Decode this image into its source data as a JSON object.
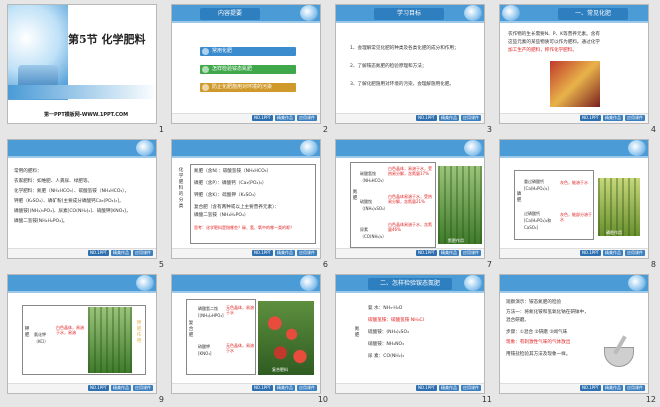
{
  "slides": [
    {
      "num": "1",
      "title": "第5节 化学肥料",
      "site": "第一PPT模板网-WWW.1PPT.COM"
    },
    {
      "num": "2",
      "header": "内容提要",
      "items": [
        "常用化肥",
        "怎样检验铵态氮肥",
        "防止化肥施用对环境的污染"
      ]
    },
    {
      "num": "3",
      "header": "学习目标",
      "items": [
        "1、会理解常见化肥的种类及各类化肥的成分和作用；",
        "2、了解铵态氮肥的检验原理和方法；",
        "3、了解化肥施用对环境的污染，会理解施用化肥。"
      ]
    },
    {
      "num": "4",
      "header": "一、常见化肥",
      "lines": [
        "农作物的生长需要N、P、K等营养元素。含有",
        "这些元素的某些物质可以作为肥料。通过化学",
        "加工生产的肥料，称作化学肥料。"
      ]
    },
    {
      "num": "5",
      "lines": [
        "常用的肥料：",
        "农家肥料：如堆肥、人粪尿、绿肥等。",
        "化学肥料：氮肥（NH₄HCO₃）、碳酸氢铵（NH₄HCO₃），",
        "钾肥（K₂SO₄）、磷矿粉[主要成分磷酸钙Ca₃(PO₄)₂]，",
        "磷酸铵[(NH₄)₃PO₄]、尿素[CO(NH₂)₂]、硝酸钾[KNO₃]，",
        "磷酸二氢铵[NH₄H₂PO₄]。"
      ]
    },
    {
      "num": "6",
      "side": "化学肥料的分类",
      "lines": [
        "氮肥（含N）：碳酸氢铵（NH₄HCO₃）",
        "磷肥（含P）：磷酸钙（Ca₃(PO₄)₂）",
        "钾肥（含K）：硫酸钾（K₂SO₄）",
        "复合肥（含有两种或以上主要营养元素）：",
        "磷酸二氢铵（NH₄H₂PO₄）",
        "思考：化学肥料是指哪些？碳、氢、氧中的哪一类的呢？"
      ]
    },
    {
      "num": "7",
      "side": "氮肥",
      "rows": [
        "碳酸氢铵（NH₄HCO₃）",
        "硫酸铵（(NH₄)₂SO₄）",
        "尿素（CO(NH₂)₂）"
      ],
      "notes": [
        "白色晶体，易溶于水，受热易分解，含氮量17%",
        "白色晶体易溶于水，受热易分解，含氮量21%",
        "白色晶体易溶于水，含氮量46%"
      ],
      "caption": "氮肥作用"
    },
    {
      "num": "8",
      "side": "磷肥",
      "rows": [
        "重过磷酸钙[Ca(H₂PO₄)₂]",
        "过磷酸钙[Ca(H₂PO₄)₂和CaSO₄]"
      ],
      "notes": [
        "灰色，能溶于水",
        "灰色，能部分溶于水"
      ],
      "caption": "磷肥作用"
    },
    {
      "num": "9",
      "side": "钾肥",
      "row": "氯化钾（KCl）",
      "note": "白色晶体，易溶于水，易溶",
      "tag": "钾肥作用"
    },
    {
      "num": "10",
      "side": "复合肥",
      "rows": [
        "磷酸氢二铵[(NH₄)₂HPO₄]",
        "硝酸钾[KNO₃]"
      ],
      "notes": [
        "无色晶体，易溶于水",
        "无色晶体，易溶于水"
      ],
      "caption": "复合肥料"
    },
    {
      "num": "11",
      "header": "二、怎样检验铵态氮肥",
      "lines": [
        "氨   水：NH₃·H₂O",
        "碳酸氢铵：碳酸氢铵  NH₄Cl",
        "硫酸铵：(NH₄)₂SO₄",
        "硝酸铵：NH₄NO₃",
        "尿    素：CO(NH₂)₂"
      ],
      "side": "氮肥"
    },
    {
      "num": "12",
      "lines": [
        "观察演示：铵态氮肥的检验",
        "方法一：将氮化铵和氢氧化钠在研钵中，",
        "混合研磨。",
        "步骤：①混合 ②研磨 ③闻气味",
        "现象：有刺激性气味的气体放出",
        "用铵盐检验其方法及现象一样。"
      ]
    }
  ],
  "footer": {
    "btn1": "NO.1PPT",
    "btn2": "精美作品",
    "btn3": "应用课件"
  },
  "colors": {
    "accent": "#4a9bd6",
    "dark": "#2e7fc0",
    "red": "#e02020",
    "bar1": "#3a8ccf",
    "bar2": "#3fa84a",
    "bar3": "#d0992b"
  }
}
